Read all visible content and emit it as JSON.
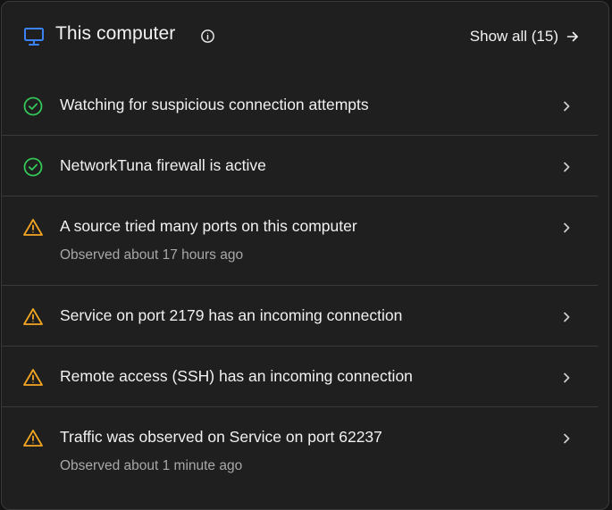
{
  "header": {
    "title": "This computer",
    "show_all_label": "Show all (15)",
    "icon": "monitor-icon",
    "accent": "#3b82f6"
  },
  "colors": {
    "ok": "#34c759",
    "warning": "#f5a623",
    "background": "#1f1f1f",
    "divider": "#3a3a3a"
  },
  "items": [
    {
      "status": "ok",
      "label": "Watching for suspicious connection attempts"
    },
    {
      "status": "ok",
      "label": "NetworkTuna firewall is active"
    },
    {
      "status": "warning",
      "label": "A source tried many ports on this computer",
      "sub": "Observed about 17 hours ago"
    },
    {
      "status": "warning",
      "label": "Service on port 2179 has an incoming connection"
    },
    {
      "status": "warning",
      "label": "Remote access (SSH) has an incoming connection"
    },
    {
      "status": "warning",
      "label": "Traffic was observed on Service on port 62237",
      "sub": "Observed about 1 minute ago"
    }
  ]
}
